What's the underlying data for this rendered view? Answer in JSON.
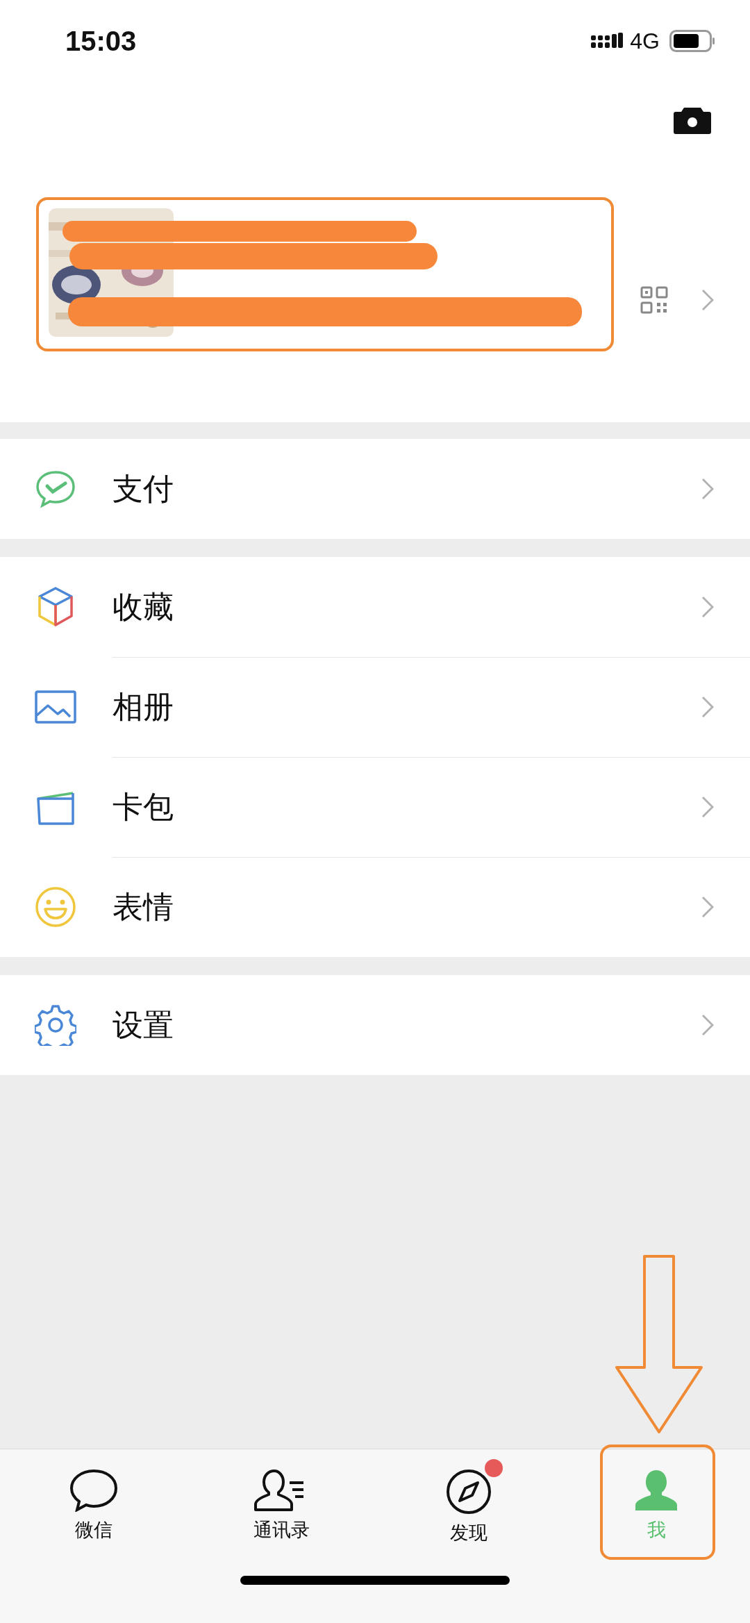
{
  "status_bar": {
    "time": "15:03",
    "network": "4G"
  },
  "menu_groups": [
    [
      {
        "kind": "pay",
        "label": "支付"
      }
    ],
    [
      {
        "kind": "favorites",
        "label": "收藏"
      },
      {
        "kind": "album",
        "label": "相册"
      },
      {
        "kind": "cards",
        "label": "卡包"
      },
      {
        "kind": "stickers",
        "label": "表情"
      }
    ],
    [
      {
        "kind": "settings",
        "label": "设置"
      }
    ]
  ],
  "tabs": [
    {
      "kind": "chats",
      "label": "微信",
      "selected": false,
      "badge": false
    },
    {
      "kind": "contacts",
      "label": "通讯录",
      "selected": false,
      "badge": false
    },
    {
      "kind": "discover",
      "label": "发现",
      "selected": false,
      "badge": true
    },
    {
      "kind": "me",
      "label": "我",
      "selected": true,
      "badge": false
    }
  ]
}
